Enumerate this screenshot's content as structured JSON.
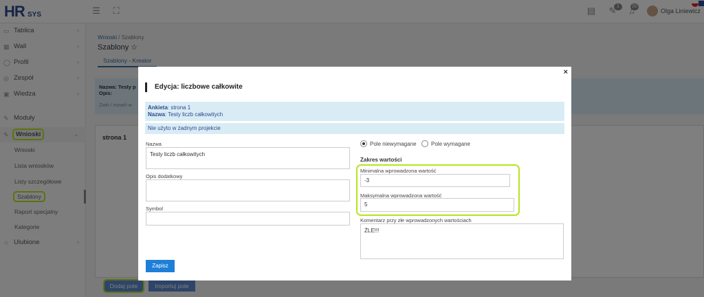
{
  "header": {
    "logo_main": "HR",
    "logo_sub": "SYS",
    "user_name": "Olga Liniewicz",
    "badges": [
      "1",
      "20"
    ]
  },
  "sidebar": {
    "items": [
      {
        "label": "Tablica"
      },
      {
        "label": "Wall"
      },
      {
        "label": "Profil"
      },
      {
        "label": "Zespół"
      },
      {
        "label": "Wiedza"
      },
      {
        "label": "Moduły"
      },
      {
        "label": "Wnioski"
      }
    ],
    "sub_items": [
      {
        "label": "Wnioski"
      },
      {
        "label": "Lista wniosków"
      },
      {
        "label": "Listy szczegółowe"
      },
      {
        "label": "Szablony"
      },
      {
        "label": "Raport specjalny"
      },
      {
        "label": "Kategorie"
      }
    ],
    "favorites_label": "Ulubione"
  },
  "main": {
    "breadcrumb_link": "Wnioski",
    "breadcrumb_sep": " / ",
    "breadcrumb_current": "Szablony",
    "page_title": "Szablony ☆",
    "tab_label": "Szablony - Kreator",
    "info_text": "Nazwa: Testy p",
    "info_text2": "Opis:",
    "info_toggle": "Zwiń / rozwiń w",
    "card_title": "strona 1",
    "add_field_button": "Dodaj pole",
    "import_field_button": "Importuj pole"
  },
  "modal": {
    "title": "Edycja: liczbowe całkowite",
    "survey_label": "Ankieta",
    "survey_value": ": strona 1",
    "name_label": "Nazwa",
    "name_value": ": Testy liczb całkowitych",
    "usage_text": "Nie użyto w żadnym projekcie",
    "field_name_label": "Nazwa",
    "field_name_value": "Testy liczb całkowitych",
    "extra_desc_label": "Opis dodatkowy",
    "extra_desc_value": "",
    "symbol_label": "Symbol",
    "symbol_value": "",
    "radio_optional": "Pole niewymagane",
    "radio_required": "Pole wymagane",
    "range_heading": "Zakres wartości",
    "min_label": "Minimalna wprowadzona wartość",
    "min_value": "-3",
    "max_label": "Maksymalna wprowadzona wartość",
    "max_value": "5",
    "comment_label": "Komentarz przy złe wprowadzonych wartościach",
    "comment_value": "ŹLE!!!",
    "save_button": "Zapisz",
    "close_glyph": "×"
  },
  "colors": {
    "accent": "#1e7fd8",
    "highlight": "#b5e61d",
    "info_bg": "#d9ecf5"
  }
}
